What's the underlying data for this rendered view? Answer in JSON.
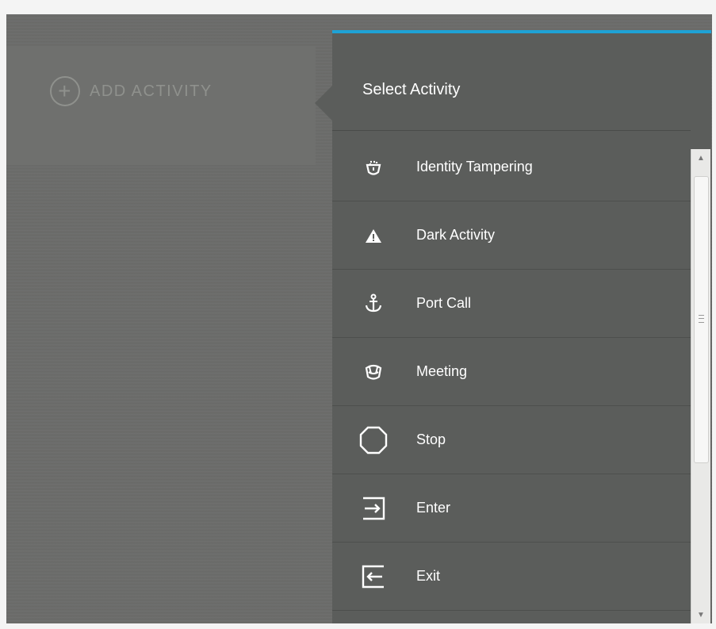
{
  "header": {
    "add_activity_label": "ADD ACTIVITY",
    "add_icon": "plus-circle-icon"
  },
  "panel": {
    "title": "Select Activity",
    "accent_color": "#1ea2d6",
    "items": [
      {
        "label": "Identity Tampering",
        "icon": "identity-tampering-icon"
      },
      {
        "label": "Dark Activity",
        "icon": "warning-triangle-icon"
      },
      {
        "label": "Port Call",
        "icon": "anchor-icon"
      },
      {
        "label": "Meeting",
        "icon": "meeting-icon"
      },
      {
        "label": "Stop",
        "icon": "octagon-stop-icon"
      },
      {
        "label": "Enter",
        "icon": "enter-icon"
      },
      {
        "label": "Exit",
        "icon": "exit-icon"
      }
    ]
  }
}
